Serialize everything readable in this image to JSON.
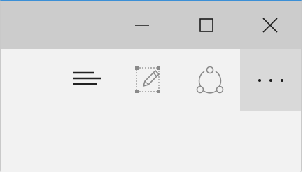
{
  "window": {
    "accent_color": "#3b8fd6",
    "titlebar_color": "#cccccc",
    "toolbar_color": "#f2f2f2",
    "more_button_bg": "#d9d9d9"
  },
  "caption_buttons": [
    {
      "name": "minimize",
      "icon": "minimize-icon"
    },
    {
      "name": "maximize",
      "icon": "maximize-icon"
    },
    {
      "name": "close",
      "icon": "close-icon"
    }
  ],
  "toolbar": {
    "items": [
      {
        "name": "hub",
        "icon": "hub-icon"
      },
      {
        "name": "web-note",
        "icon": "web-note-icon"
      },
      {
        "name": "share",
        "icon": "share-icon"
      },
      {
        "name": "more",
        "icon": "more-icon",
        "label": "···"
      }
    ]
  }
}
